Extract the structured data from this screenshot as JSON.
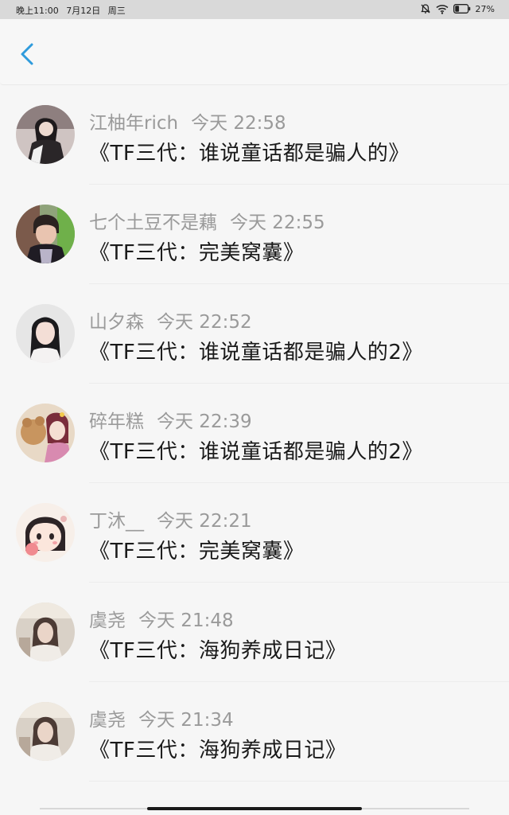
{
  "status_bar": {
    "time": "晚上11:00",
    "date": "7月12日",
    "weekday": "周三",
    "battery": "27%"
  },
  "header": {
    "back_icon": "chevron-left-icon",
    "accent_color": "#2f9bdc"
  },
  "messages": [
    {
      "name": "江柚年rich",
      "time": "今天 22:58",
      "text": "《TF三代：谁说童话都是骗人的》"
    },
    {
      "name": "七个土豆不是藕",
      "time": "今天 22:55",
      "text": "《TF三代：完美窝囊》"
    },
    {
      "name": "山夕森",
      "time": "今天 22:52",
      "text": "《TF三代：谁说童话都是骗人的2》"
    },
    {
      "name": "碎年糕",
      "time": "今天 22:39",
      "text": "《TF三代：谁说童话都是骗人的2》"
    },
    {
      "name": "丁沐__",
      "time": "今天 22:21",
      "text": "《TF三代：完美窝囊》"
    },
    {
      "name": "虞尧",
      "time": "今天 21:48",
      "text": "《TF三代：海狗养成日记》"
    },
    {
      "name": "虞尧",
      "time": "今天 21:34",
      "text": "《TF三代：海狗养成日记》"
    }
  ]
}
